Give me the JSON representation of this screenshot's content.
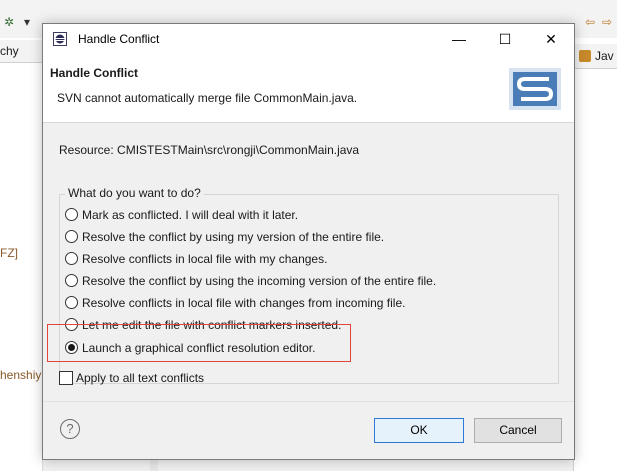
{
  "background": {
    "left_tab_label": "chy",
    "left_texts": [
      "FZ]",
      "henshiy"
    ],
    "right_tab_label": "Jav"
  },
  "dialog": {
    "window_title": "Handle Conflict",
    "header_title": "Handle Conflict",
    "header_description": "SVN cannot automatically merge file CommonMain.java.",
    "resource": "Resource: CMISTESTMain\\src\\rongji\\CommonMain.java",
    "question_label": "What do you want to do?",
    "options": [
      {
        "label": "Mark as conflicted.  I will deal with it later.",
        "selected": false
      },
      {
        "label": "Resolve the conflict by using my version of the entire file.",
        "selected": false
      },
      {
        "label": "Resolve conflicts in local file with my changes.",
        "selected": false
      },
      {
        "label": "Resolve the conflict by using the incoming version of the entire file.",
        "selected": false
      },
      {
        "label": "Resolve conflicts in local file with changes from incoming file.",
        "selected": false
      },
      {
        "label": "Let me edit the file with conflict markers inserted.",
        "selected": false
      },
      {
        "label": "Launch a graphical conflict resolution editor.",
        "selected": true
      }
    ],
    "apply_all_label": "Apply to all text conflicts",
    "apply_all_checked": false,
    "ok_label": "OK",
    "cancel_label": "Cancel",
    "help_glyph": "?",
    "minimize_glyph": "—",
    "maximize_glyph": "☐",
    "close_glyph": "✕"
  },
  "colors": {
    "highlight_box": "#e0463a",
    "ok_border": "#2e78d6"
  }
}
